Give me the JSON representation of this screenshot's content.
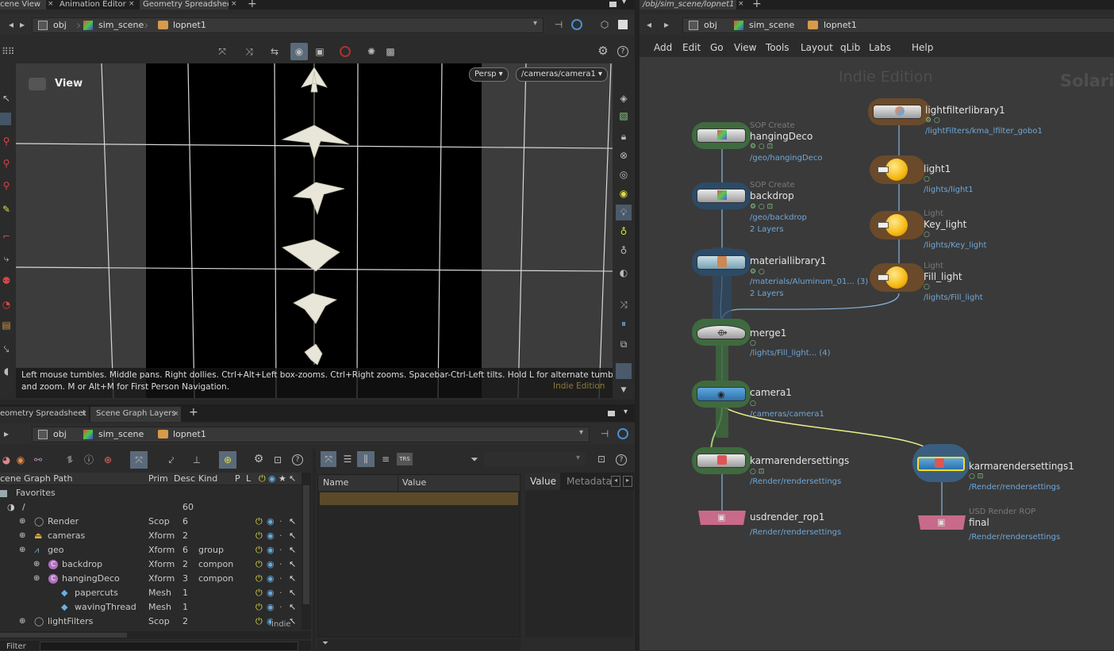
{
  "left_tabs": [
    {
      "label": "cene View"
    },
    {
      "label": "Animation Editor"
    },
    {
      "label": "Geometry Spreadsheet"
    }
  ],
  "right_tabs": [
    {
      "label": "/obj/sim_scene/lopnet1"
    }
  ],
  "path": {
    "obj": "obj",
    "scene": "sim_scene",
    "lop": "lopnet1"
  },
  "viewport": {
    "title": "View",
    "persp": "Persp",
    "camera": "/cameras/camera1",
    "hint_line1": "Left mouse tumbles. Middle pans. Right dollies. Ctrl+Alt+Left box-zooms. Ctrl+Right zooms. Spacebar-Ctrl-Left tilts. Hold L for alternate tumble, dolly,",
    "hint_line2": "and zoom. M or Alt+M for First Person Navigation.",
    "watermark": "Indie Edition"
  },
  "bottom_tabs": [
    {
      "label": "eometry Spreadsheet"
    },
    {
      "label": "Scene Graph Layers"
    }
  ],
  "scene_graph": {
    "columns": [
      "cene Graph Path",
      "Prim",
      "Desc",
      "Kind",
      "P",
      "L"
    ],
    "favorites": "Favorites",
    "rows": [
      {
        "name": "/",
        "prim": "",
        "desc": "60",
        "kind": ""
      },
      {
        "name": "Render",
        "prim": "Scop",
        "desc": "6",
        "kind": ""
      },
      {
        "name": "cameras",
        "prim": "Xform",
        "desc": "2",
        "kind": ""
      },
      {
        "name": "geo",
        "prim": "Xform",
        "desc": "6",
        "kind": "group"
      },
      {
        "name": "backdrop",
        "prim": "Xform",
        "desc": "2",
        "kind": "compon"
      },
      {
        "name": "hangingDeco",
        "prim": "Xform",
        "desc": "3",
        "kind": "compon"
      },
      {
        "name": "papercuts",
        "prim": "Mesh",
        "desc": "1",
        "kind": ""
      },
      {
        "name": "wavingThread",
        "prim": "Mesh",
        "desc": "1",
        "kind": ""
      },
      {
        "name": "lightFilters",
        "prim": "Scop",
        "desc": "2",
        "kind": ""
      }
    ],
    "indie": "Indie",
    "filter": "Filter"
  },
  "props": {
    "name_col": "Name",
    "value_col": "Value",
    "right_tabs": [
      "Value",
      "Metadata"
    ],
    "trs": "TRS"
  },
  "network": {
    "menus": [
      "Add",
      "Edit",
      "Go",
      "View",
      "Tools",
      "Layout",
      "qLib",
      "Labs",
      "Help"
    ],
    "watermark": "Indie Edition",
    "context": "Solaris",
    "nodes": {
      "hangingDeco": {
        "type": "SOP Create",
        "name": "hangingDeco",
        "path": "/geo/hangingDeco"
      },
      "backdrop": {
        "type": "SOP Create",
        "name": "backdrop",
        "path": "/geo/backdrop",
        "layers": "2 Layers"
      },
      "materiallibrary1": {
        "name": "materiallibrary1",
        "path": "/materials/Aluminum_01... (3)",
        "layers": "2 Layers"
      },
      "merge1": {
        "name": "merge1",
        "path": "/lights/Fill_light... (4)"
      },
      "camera1": {
        "name": "camera1",
        "path": "/cameras/camera1"
      },
      "karma1": {
        "name": "karmarendersettings",
        "path": "/Render/rendersettings"
      },
      "usdrender": {
        "name": "usdrender_rop1",
        "path": "/Render/rendersettings"
      },
      "lightfilter": {
        "name": "lightfilterlibrary1",
        "path": "/lightFilters/kma_lfilter_gobo1"
      },
      "light1": {
        "name": "light1",
        "path": "/lights/light1"
      },
      "key": {
        "type": "Light",
        "name": "Key_light",
        "path": "/lights/Key_light"
      },
      "fill": {
        "type": "Light",
        "name": "Fill_light",
        "path": "/lights/Fill_light"
      },
      "karma2": {
        "name": "karmarendersettings1",
        "path": "/Render/rendersettings"
      },
      "final": {
        "type": "USD Render ROP",
        "name": "final",
        "path": "/Render/rendersettings"
      }
    }
  }
}
